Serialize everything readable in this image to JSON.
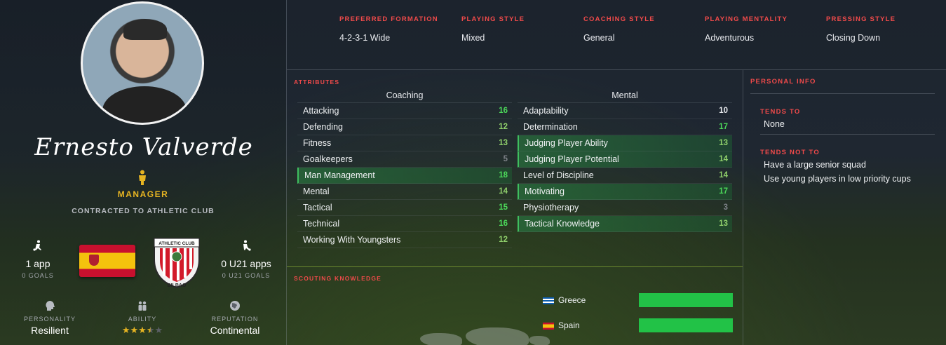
{
  "profile": {
    "name": "Ernesto Valverde",
    "role": "MANAGER",
    "contract": "CONTRACTED TO ATHLETIC CLUB",
    "apps": "1 app",
    "goals": "0 GOALS",
    "u21_apps": "0 U21 apps",
    "u21_goals": "0 U21 GOALS",
    "nation_flag": "spain-flag",
    "club_badge": "athletic-club-badge",
    "badge_text_top": "ATHLETIC CLUB",
    "badge_text_bottom": "BILBAO",
    "personality_label": "PERSONALITY",
    "personality": "Resilient",
    "ability_label": "ABILITY",
    "ability_stars": 3.5,
    "ability_stars_max": 5,
    "reputation_label": "REPUTATION",
    "reputation": "Continental"
  },
  "tactics": [
    {
      "label": "PREFERRED FORMATION",
      "value": "4-2-3-1 Wide"
    },
    {
      "label": "PLAYING STYLE",
      "value": "Mixed"
    },
    {
      "label": "COACHING STYLE",
      "value": "General"
    },
    {
      "label": "PLAYING MENTALITY",
      "value": "Adventurous"
    },
    {
      "label": "PRESSING STYLE",
      "value": "Closing Down"
    }
  ],
  "attributes": {
    "title": "ATTRIBUTES",
    "coaching_title": "Coaching",
    "mental_title": "Mental",
    "coaching": [
      {
        "name": "Attacking",
        "value": "16",
        "highlight": false
      },
      {
        "name": "Defending",
        "value": "12",
        "highlight": false
      },
      {
        "name": "Fitness",
        "value": "13",
        "highlight": false
      },
      {
        "name": "Goalkeepers",
        "value": "5",
        "highlight": false
      },
      {
        "name": "Man Management",
        "value": "18",
        "highlight": true
      },
      {
        "name": "Mental",
        "value": "14",
        "highlight": false
      },
      {
        "name": "Tactical",
        "value": "15",
        "highlight": false
      },
      {
        "name": "Technical",
        "value": "16",
        "highlight": false
      },
      {
        "name": "Working With Youngsters",
        "value": "12",
        "highlight": false
      }
    ],
    "mental": [
      {
        "name": "Adaptability",
        "value": "10",
        "highlight": false
      },
      {
        "name": "Determination",
        "value": "17",
        "highlight": false
      },
      {
        "name": "Judging Player Ability",
        "value": "13",
        "highlight": true
      },
      {
        "name": "Judging Player Potential",
        "value": "14",
        "highlight": true
      },
      {
        "name": "Level of Discipline",
        "value": "14",
        "highlight": false
      },
      {
        "name": "Motivating",
        "value": "17",
        "highlight": true
      },
      {
        "name": "Physiotherapy",
        "value": "3",
        "highlight": false
      },
      {
        "name": "Tactical Knowledge",
        "value": "13",
        "highlight": true
      }
    ]
  },
  "scouting": {
    "title": "SCOUTING KNOWLEDGE",
    "countries": [
      {
        "name": "Greece",
        "flag": "greece-flag",
        "knowledge": 1.0
      },
      {
        "name": "Spain",
        "flag": "spain-flag",
        "knowledge": 1.0
      }
    ]
  },
  "personal": {
    "title": "PERSONAL INFO",
    "tends_to_label": "TENDS TO",
    "tends_to": [
      "None"
    ],
    "tends_not_to_label": "TENDS NOT TO",
    "tends_not_to": [
      "Have a large senior squad",
      "Use young players in low priority cups"
    ]
  },
  "colors": {
    "accent_red": "#f04a4a",
    "accent_gold": "#e6b422",
    "bar_green": "#22c247",
    "highlight_green": "#2f7a45"
  }
}
